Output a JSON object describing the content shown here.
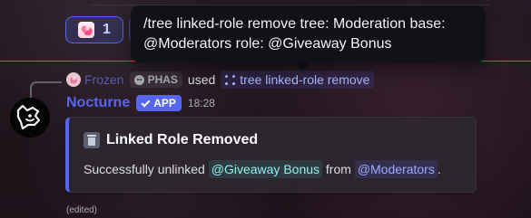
{
  "tooltip": {
    "line1": "/tree linked-role remove tree: Moderation base:",
    "line2": "@Moderators  role: @Giveaway Bonus"
  },
  "reactions": [
    {
      "count": "1"
    }
  ],
  "reply": {
    "author": "Frozen",
    "server_tag": "PHAS",
    "action": "used",
    "command": "tree linked-role remove"
  },
  "message": {
    "author": "Nocturne",
    "badge": "APP",
    "time": "18:28",
    "edited": "(edited)"
  },
  "embed": {
    "title": "Linked Role Removed",
    "prefix": "Successfully unlinked",
    "role": "@Giveaway Bonus",
    "middle": "from",
    "target": "@Moderators",
    "suffix": "."
  },
  "colors": {
    "divider": "#f23f42",
    "accent": "#5865f2",
    "role_mention": "#8ef3ef",
    "mod_mention": "#9ca8ff"
  }
}
